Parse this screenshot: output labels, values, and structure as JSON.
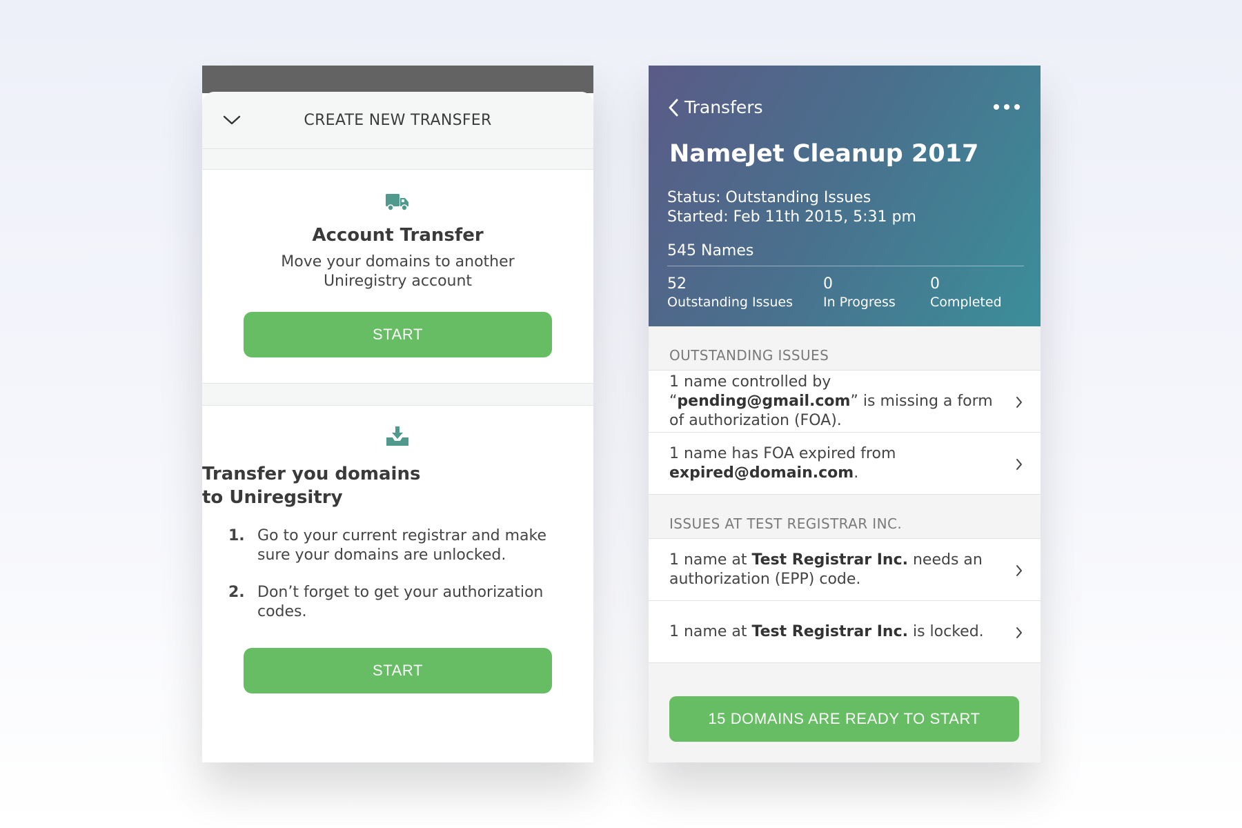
{
  "left": {
    "sheet_title": "CREATE NEW TRANSFER",
    "account_transfer": {
      "icon": "truck-icon",
      "title": "Account Transfer",
      "subtitle": "Move your domains to another Uniregistry account",
      "button": "START"
    },
    "transfer_in": {
      "icon": "download-tray-icon",
      "title_line1": "Transfer you domains",
      "title_line2": "to Uniregsitry",
      "steps": [
        {
          "num": "1.",
          "text": "Go to your current registrar and make sure your domains are unlocked."
        },
        {
          "num": "2.",
          "text": "Don’t forget to get your authorization codes."
        }
      ],
      "button": "START"
    }
  },
  "right": {
    "back_label": "Transfers",
    "title": "NameJet Cleanup 2017",
    "status": "Status: Outstanding Issues",
    "started": "Started: Feb 11th 2015, 5:31 pm",
    "names": "545 Names",
    "stats": [
      {
        "value": "52",
        "label": "Outstanding Issues"
      },
      {
        "value": "0",
        "label": "In Progress"
      },
      {
        "value": "0",
        "label": "Completed"
      }
    ],
    "sections": [
      {
        "label": "OUTSTANDING ISSUES",
        "items": [
          {
            "pre": "1 name controlled by “",
            "bold": "pending@gmail.com",
            "post": "” is missing a form of authorization (FOA)."
          },
          {
            "pre": "1 name has FOA expired from ",
            "bold": "expired@domain.com",
            "post": "."
          }
        ]
      },
      {
        "label": "ISSUES AT TEST REGISTRAR INC.",
        "items": [
          {
            "pre": "1 name at ",
            "bold": "Test Registrar Inc.",
            "post": " needs an authorization (EPP) code."
          },
          {
            "pre": "1 name at ",
            "bold": "Test Registrar Inc.",
            "post": " is locked."
          }
        ]
      }
    ],
    "ready_button": "15 DOMAINS ARE READY TO START"
  },
  "colors": {
    "accent_green": "#66bd63",
    "hero_gradient_start": "#5a5b86",
    "hero_gradient_end": "#3b8e9a",
    "icon_teal": "#4f9a8c"
  }
}
